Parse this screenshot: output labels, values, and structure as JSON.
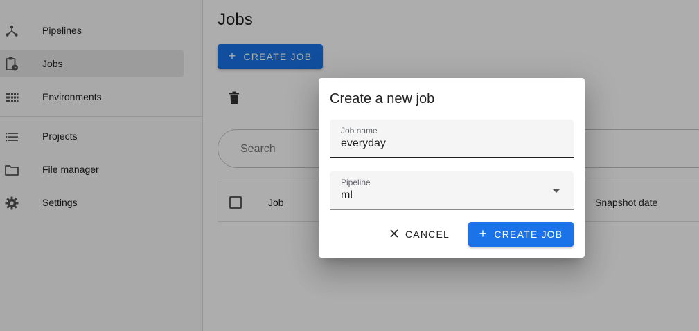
{
  "sidebar": {
    "items": [
      {
        "label": "Pipelines",
        "icon": "pipeline-icon",
        "active": false
      },
      {
        "label": "Jobs",
        "icon": "jobs-icon",
        "active": true
      },
      {
        "label": "Environments",
        "icon": "environments-icon",
        "active": false
      },
      {
        "label": "Projects",
        "icon": "projects-icon",
        "active": false
      },
      {
        "label": "File manager",
        "icon": "folder-icon",
        "active": false
      },
      {
        "label": "Settings",
        "icon": "gear-icon",
        "active": false
      }
    ]
  },
  "main": {
    "title": "Jobs",
    "create_button": {
      "label": "CREATE JOB",
      "icon": "plus-icon"
    },
    "delete_icon": "trash-icon",
    "search": {
      "placeholder": "Search"
    },
    "table": {
      "columns": [
        "Job",
        "Snapshot date"
      ]
    }
  },
  "dialog": {
    "title": "Create a new job",
    "job_name": {
      "label": "Job name",
      "value": "everyday"
    },
    "pipeline": {
      "label": "Pipeline",
      "value": "ml"
    },
    "cancel_label": "CANCEL",
    "create_label": "CREATE JOB"
  },
  "colors": {
    "primary": "#1a73e8",
    "overlay": "rgba(0,0,0,0.32)",
    "active_nav": "#e6e6e6"
  }
}
